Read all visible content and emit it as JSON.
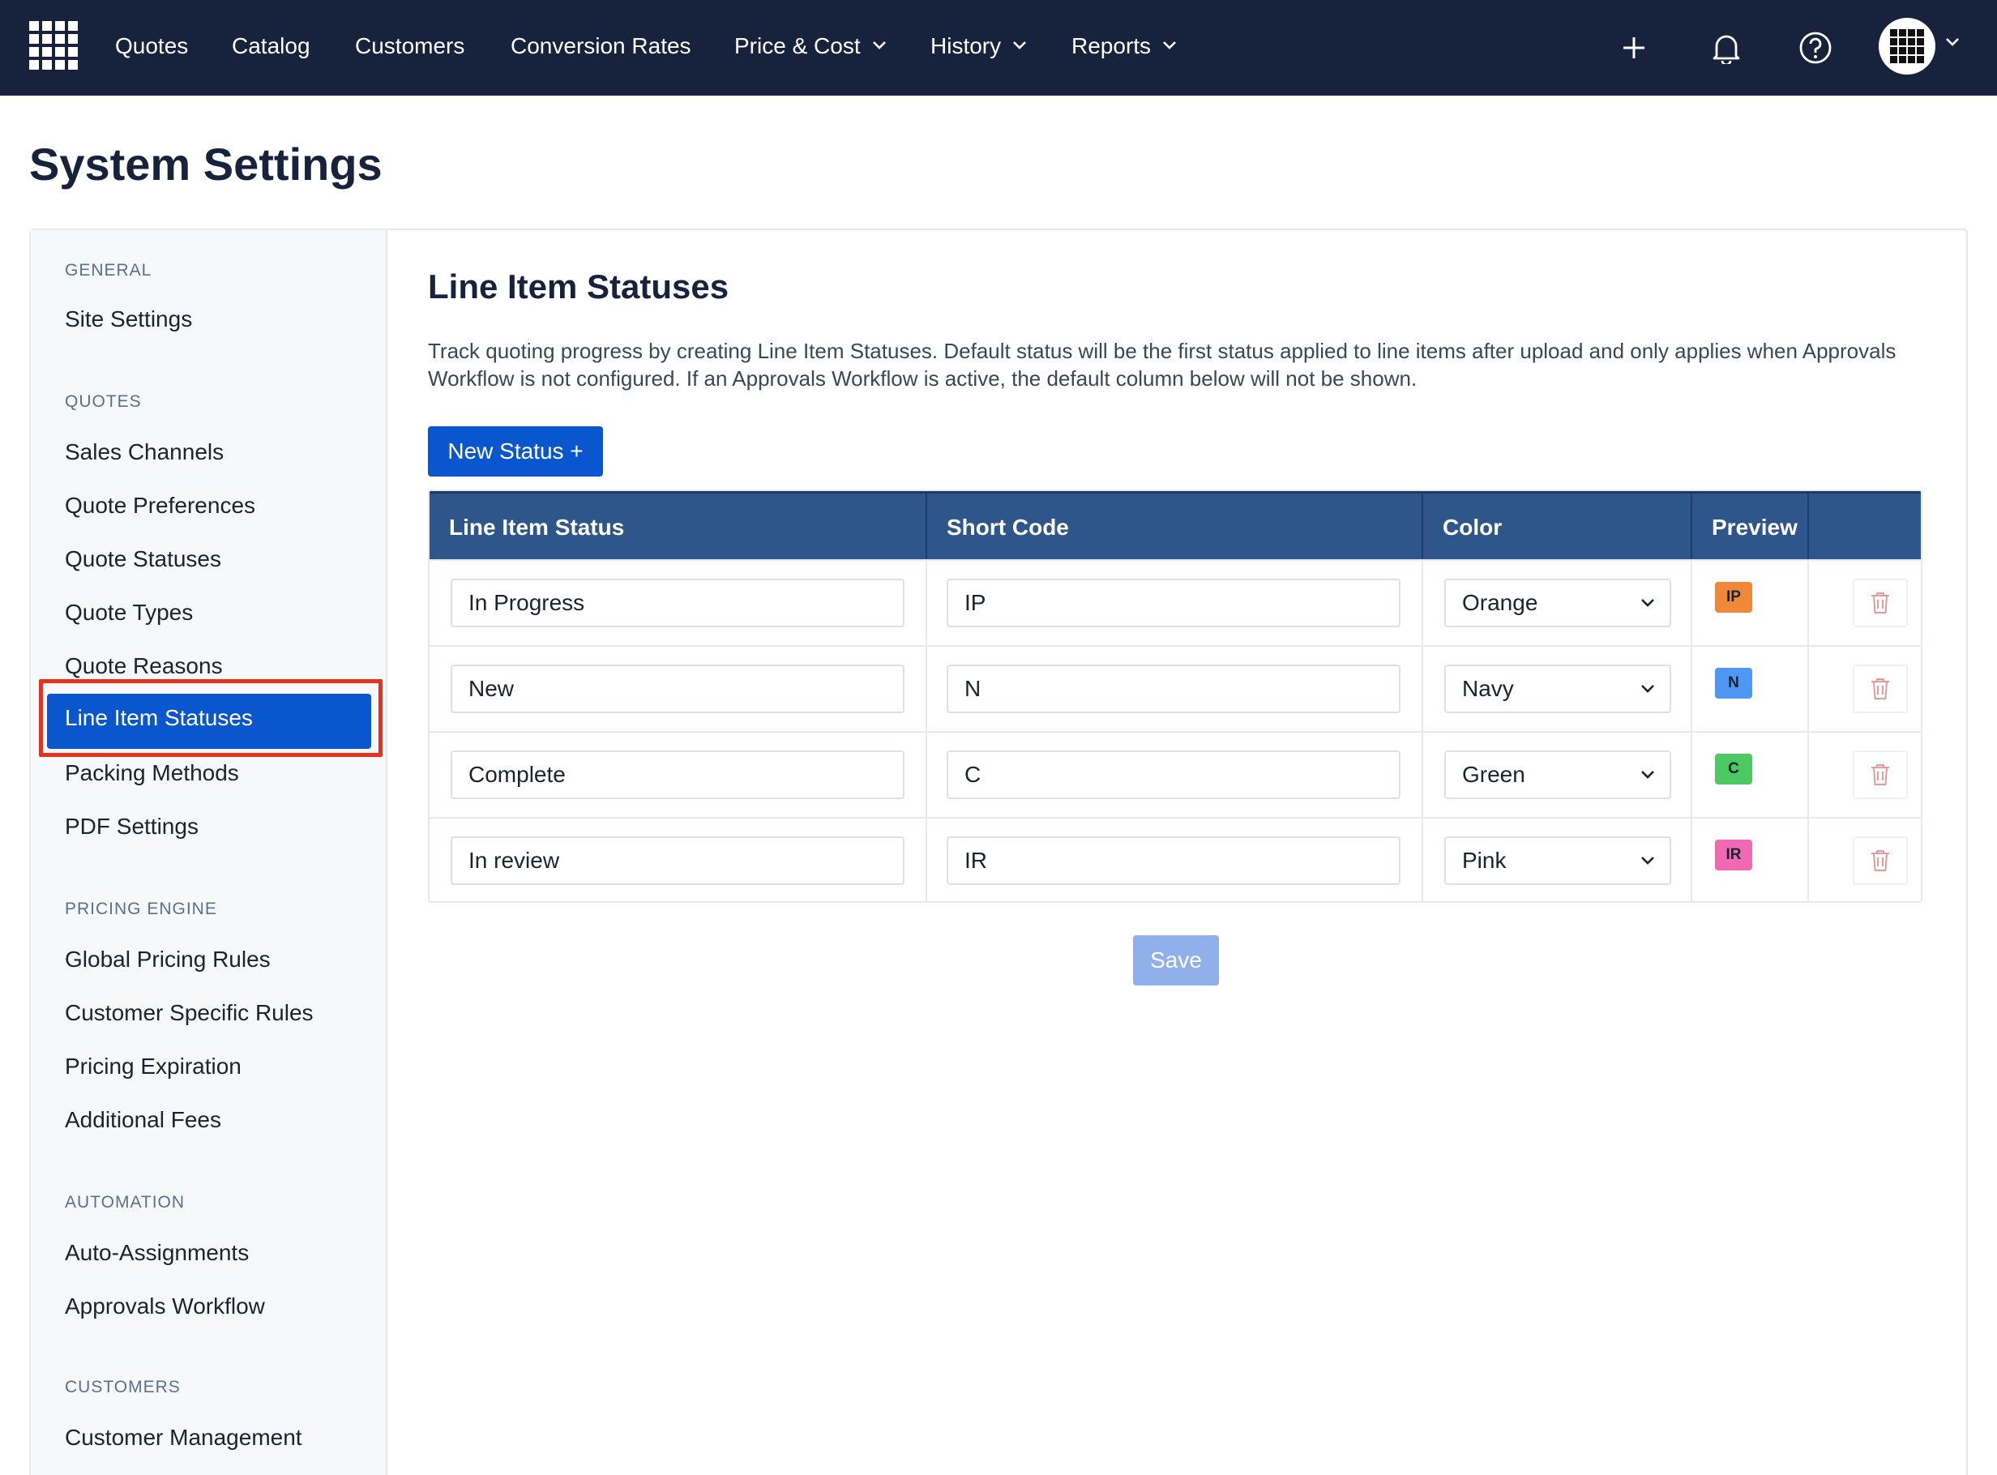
{
  "nav": {
    "items": [
      {
        "label": "Quotes",
        "dropdown": false
      },
      {
        "label": "Catalog",
        "dropdown": false
      },
      {
        "label": "Customers",
        "dropdown": false
      },
      {
        "label": "Conversion Rates",
        "dropdown": false
      },
      {
        "label": "Price & Cost",
        "dropdown": true
      },
      {
        "label": "History",
        "dropdown": true
      },
      {
        "label": "Reports",
        "dropdown": true
      }
    ],
    "icons": [
      "plus-icon",
      "bell-icon",
      "help-icon"
    ]
  },
  "page": {
    "title": "System Settings"
  },
  "sidebar": {
    "sections": [
      {
        "title": "GENERAL",
        "items": [
          "Site Settings"
        ]
      },
      {
        "title": "QUOTES",
        "items": [
          "Sales Channels",
          "Quote Preferences",
          "Quote Statuses",
          "Quote Types",
          "Quote Reasons",
          "Line Item Statuses",
          "Packing Methods",
          "PDF Settings"
        ]
      },
      {
        "title": "PRICING ENGINE",
        "items": [
          "Global Pricing Rules",
          "Customer Specific Rules",
          "Pricing Expiration",
          "Additional Fees"
        ]
      },
      {
        "title": "AUTOMATION",
        "items": [
          "Auto-Assignments",
          "Approvals Workflow"
        ]
      },
      {
        "title": "CUSTOMERS",
        "items": [
          "Customer Management"
        ]
      }
    ],
    "active_item": "Line Item Statuses"
  },
  "main": {
    "title": "Line Item Statuses",
    "description": "Track quoting progress by creating Line Item Statuses. Default status will be the first status applied to line items after upload and only applies when Approvals Workflow is not configured. If an Approvals Workflow is active, the default column below will not be shown.",
    "new_button": "New Status +",
    "save_button": "Save",
    "table": {
      "headers": [
        "Line Item Status",
        "Short Code",
        "Color",
        "Preview"
      ],
      "rows": [
        {
          "status": "In Progress",
          "code": "IP",
          "color": "Orange",
          "badge_color": "#f0883a"
        },
        {
          "status": "New",
          "code": "N",
          "color": "Navy",
          "badge_color": "#4e97f4"
        },
        {
          "status": "Complete",
          "code": "C",
          "color": "Green",
          "badge_color": "#4cc962"
        },
        {
          "status": "In review",
          "code": "IR",
          "color": "Pink",
          "badge_color": "#f069b3"
        }
      ]
    }
  },
  "colors": {
    "nav_bg": "#17233d",
    "primary": "#0a56cf",
    "table_header": "#2e568a",
    "highlight": "#e8301e",
    "trash": "#e79a9a"
  }
}
